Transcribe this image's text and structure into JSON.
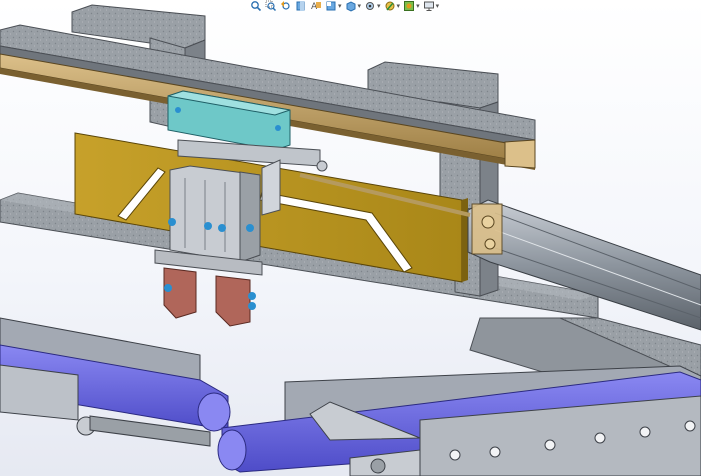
{
  "window": {
    "type": "cad-3d-viewport",
    "background_top": "#ffffff",
    "background_bottom": "#e6e9f2"
  },
  "heads_up_toolbar": {
    "buttons": [
      {
        "icon": "zoom-to-fit-icon",
        "has_dropdown": false
      },
      {
        "icon": "zoom-to-area-icon",
        "has_dropdown": false
      },
      {
        "icon": "previous-view-icon",
        "has_dropdown": false
      },
      {
        "icon": "section-view-icon",
        "has_dropdown": false
      },
      {
        "icon": "dynamic-annotation-views-icon",
        "has_dropdown": false
      },
      {
        "icon": "view-orientation-icon",
        "has_dropdown": true
      },
      {
        "icon": "display-style-icon",
        "has_dropdown": true
      },
      {
        "icon": "hide-show-items-icon",
        "has_dropdown": true
      },
      {
        "icon": "edit-appearance-icon",
        "has_dropdown": true
      },
      {
        "icon": "apply-scene-icon",
        "has_dropdown": true
      },
      {
        "icon": "view-settings-icon",
        "has_dropdown": true
      }
    ]
  },
  "model": {
    "components": [
      "steel-frame-upper-support",
      "linear-guide-rail",
      "guide-carriage-block",
      "cam-plate",
      "pneumatic-gripper",
      "gripper-jaws",
      "pneumatic-cylinder",
      "base-frame-plate",
      "conveyor-left",
      "conveyor-right",
      "conveyor-belt",
      "guide-plate"
    ],
    "colors": {
      "steel_frame": "#9aa0a6",
      "rail": "#c8a76a",
      "carriage": "#6ec8c8",
      "cam_plate": "#b8941f",
      "gripper_body": "#c8ccd2",
      "jaws": "#b0665a",
      "fasteners": "#2a8fd0",
      "cylinder": "#9aa3ad",
      "conveyor_frame": "#a3a9b3",
      "belt": "#6a68e0"
    }
  }
}
